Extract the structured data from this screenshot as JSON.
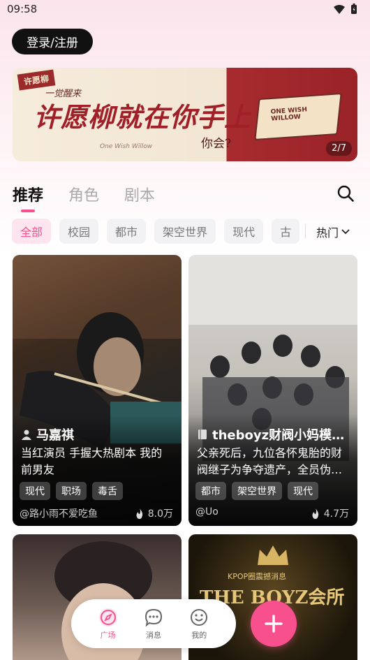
{
  "status_bar": {
    "time": "09:58"
  },
  "header": {
    "login_label": "登录/注册"
  },
  "banner": {
    "tag": "许愿柳",
    "subtitle": "一觉醒来",
    "title": "许愿柳就在你手上",
    "question": "你会?",
    "signature": "One Wish Willow",
    "card_text": "ONE WISH WILLOW",
    "counter": "2/7"
  },
  "main_tabs": [
    {
      "label": "推荐",
      "active": true
    },
    {
      "label": "角色",
      "active": false
    },
    {
      "label": "剧本",
      "active": false
    }
  ],
  "categories": [
    {
      "label": "全部",
      "active": true
    },
    {
      "label": "校园",
      "active": false
    },
    {
      "label": "都市",
      "active": false
    },
    {
      "label": "架空世界",
      "active": false
    },
    {
      "label": "现代",
      "active": false
    },
    {
      "label": "古",
      "active": false
    }
  ],
  "sort": {
    "label": "热门"
  },
  "cards": [
    {
      "title": "马嘉祺",
      "title_icon": "person-icon",
      "desc": "当红演员 手握大热剧本 我的前男友",
      "tags": [
        "现代",
        "职场",
        "毒舌"
      ],
      "author": "@路小雨不爱吃鱼",
      "heat": "8.0万"
    },
    {
      "title": "theboyz财阀小妈模…",
      "title_icon": "book-icon",
      "desc": "父亲死后，九位各怀鬼胎的财阀继子为争夺遗产，全员伪…",
      "tags": [
        "都市",
        "架空世界",
        "现代"
      ],
      "author": "@Uo",
      "heat": "4.7万"
    },
    {
      "poster_sub": "KPOP圈震撼消息",
      "poster_title": "THE BOYZ会所"
    }
  ],
  "bottom_nav": [
    {
      "label": "广场",
      "icon": "compass-icon",
      "active": true
    },
    {
      "label": "消息",
      "icon": "chat-icon",
      "active": false
    },
    {
      "label": "我的",
      "icon": "smile-icon",
      "active": false
    }
  ],
  "colors": {
    "accent": "#f7508c",
    "chip_bg": "#f2f2f4"
  }
}
